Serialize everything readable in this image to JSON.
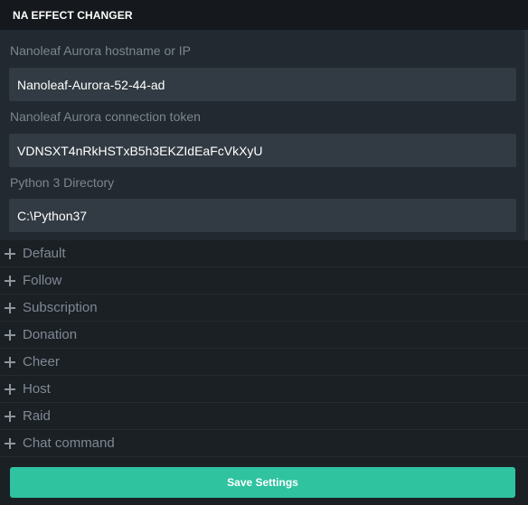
{
  "header": {
    "title": "NA EFFECT CHANGER"
  },
  "settings": {
    "hostname": {
      "label": "Nanoleaf Aurora hostname or IP",
      "value": "Nanoleaf-Aurora-52-44-ad"
    },
    "token": {
      "label": "Nanoleaf Aurora connection token",
      "value": "VDNSXT4nRkHSTxB5h3EKZIdEaFcVkXyU"
    },
    "python_dir": {
      "label": "Python 3 Directory",
      "value": "C:\\Python37"
    }
  },
  "accordion": {
    "items": [
      {
        "label": "Default",
        "icon": "plus-icon"
      },
      {
        "label": "Follow",
        "icon": "plus-icon"
      },
      {
        "label": "Subscription",
        "icon": "plus-icon"
      },
      {
        "label": "Donation",
        "icon": "plus-icon"
      },
      {
        "label": "Cheer",
        "icon": "plus-icon"
      },
      {
        "label": "Host",
        "icon": "plus-icon"
      },
      {
        "label": "Raid",
        "icon": "plus-icon"
      },
      {
        "label": "Chat command",
        "icon": "plus-icon"
      }
    ]
  },
  "footer": {
    "save_label": "Save Settings"
  },
  "colors": {
    "background": "#1b2025",
    "panel": "#222930",
    "input": "#323b43",
    "accent": "#2fc3a0",
    "muted_text": "#7c868f"
  }
}
